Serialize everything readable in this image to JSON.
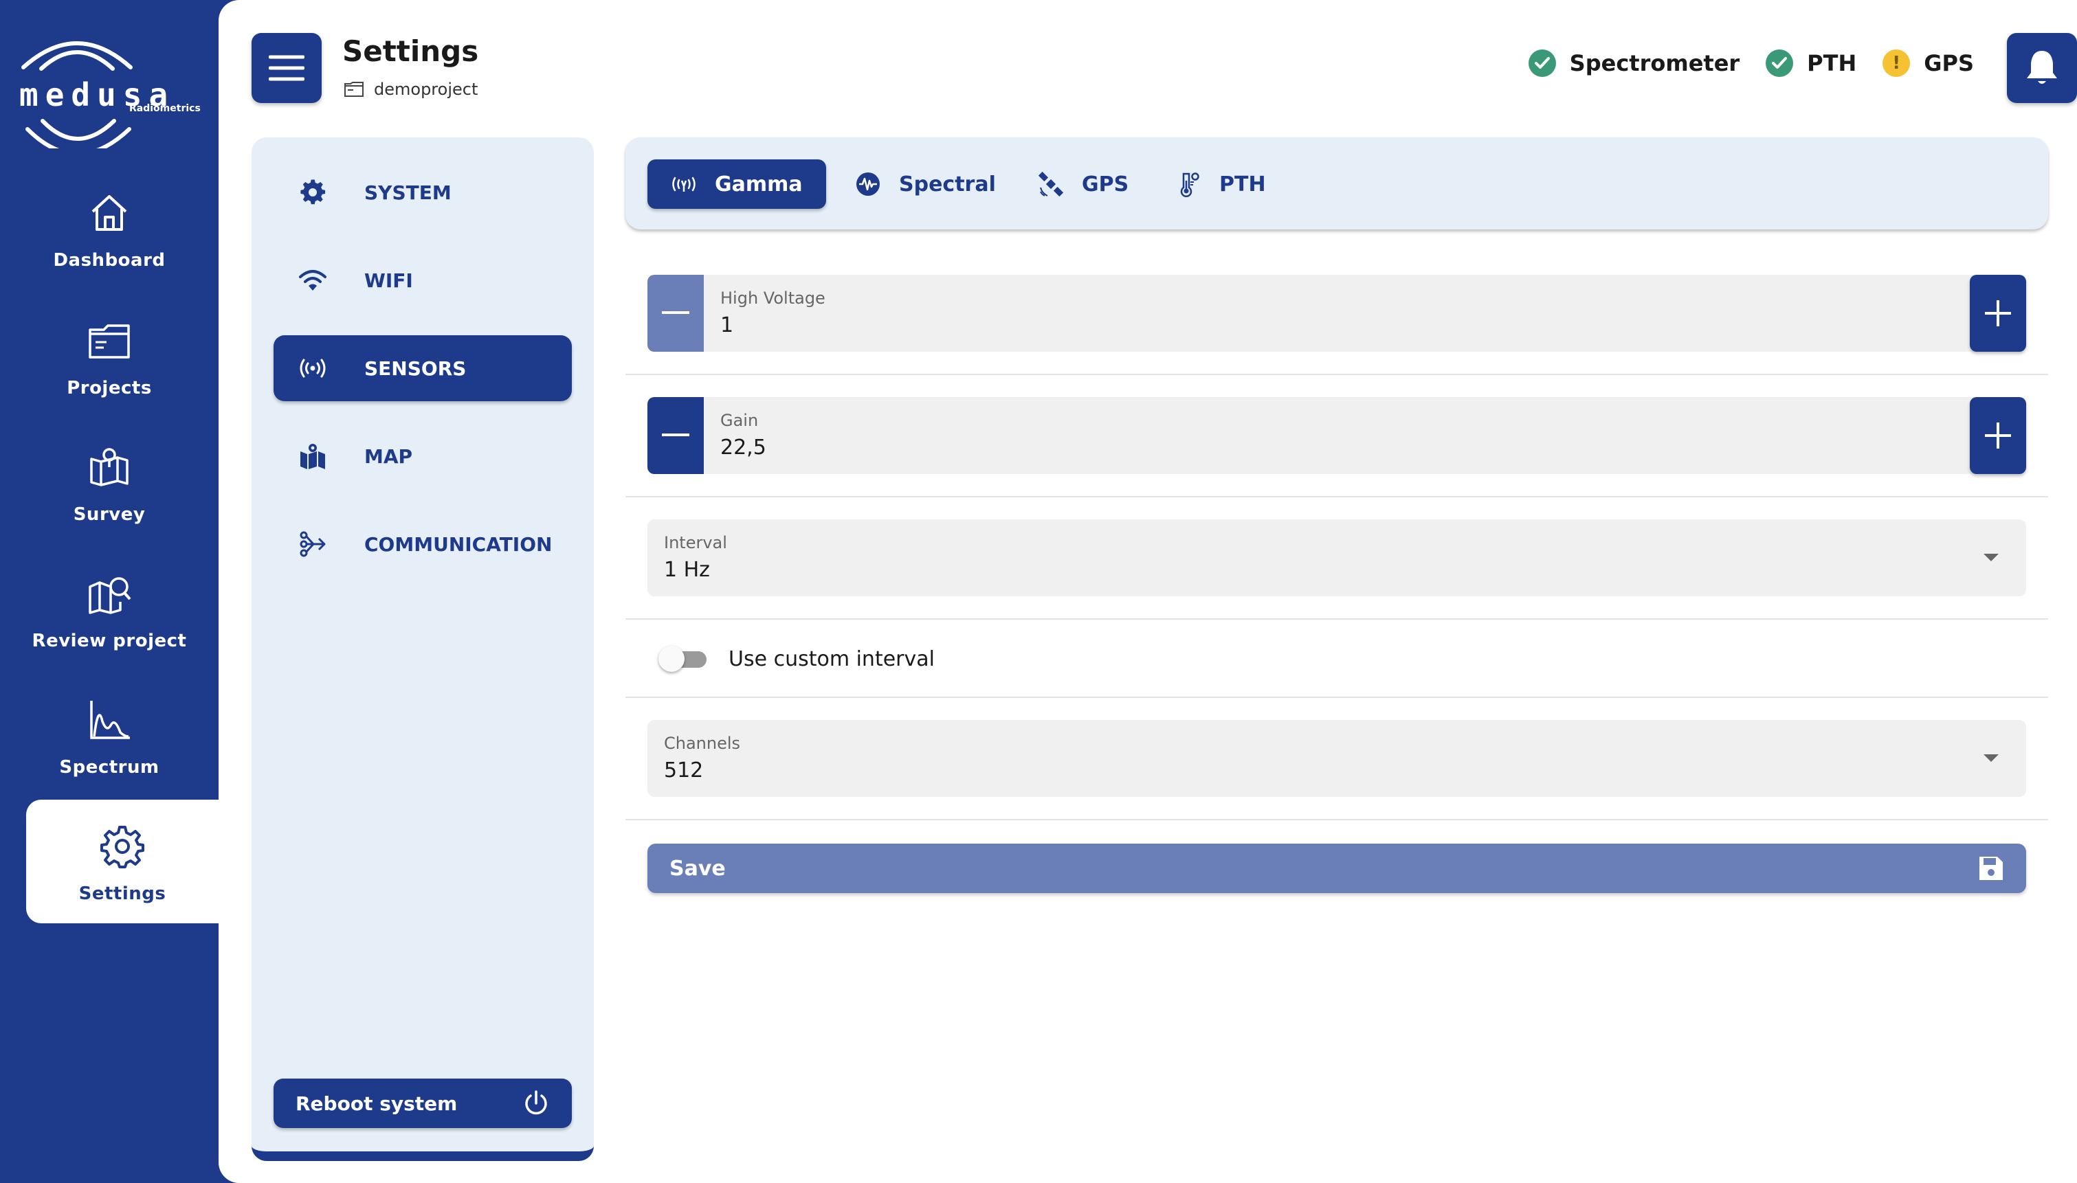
{
  "brand": {
    "name": "medusa",
    "tagline": "Radiometrics"
  },
  "sidebar": {
    "items": [
      {
        "label": "Dashboard",
        "icon": "home-icon"
      },
      {
        "label": "Projects",
        "icon": "folder-icon"
      },
      {
        "label": "Survey",
        "icon": "map-pin-icon"
      },
      {
        "label": "Review project",
        "icon": "map-search-icon"
      },
      {
        "label": "Spectrum",
        "icon": "spectrum-chart-icon"
      },
      {
        "label": "Settings",
        "icon": "gear-icon",
        "active": true
      }
    ]
  },
  "header": {
    "title": "Settings",
    "project": "demoproject",
    "statuses": [
      {
        "label": "Spectrometer",
        "state": "ok"
      },
      {
        "label": "PTH",
        "state": "ok"
      },
      {
        "label": "GPS",
        "state": "warning",
        "glyph": "!"
      }
    ]
  },
  "settings_menu": {
    "items": [
      {
        "label": "SYSTEM",
        "icon": "cog-icon"
      },
      {
        "label": "WIFI",
        "icon": "wifi-icon"
      },
      {
        "label": "SENSORS",
        "icon": "sensor-icon",
        "active": true
      },
      {
        "label": "MAP",
        "icon": "map-icon"
      },
      {
        "label": "COMMUNICATION",
        "icon": "share-icon"
      }
    ],
    "reboot_label": "Reboot system"
  },
  "tabs": [
    {
      "label": "Gamma",
      "icon": "gamma-icon",
      "active": true
    },
    {
      "label": "Spectral",
      "icon": "waveform-icon"
    },
    {
      "label": "GPS",
      "icon": "satellite-icon"
    },
    {
      "label": "PTH",
      "icon": "thermometer-icon"
    }
  ],
  "form": {
    "high_voltage": {
      "label": "High Voltage",
      "value": "1",
      "decrement_enabled": false
    },
    "gain": {
      "label": "Gain",
      "value": "22,5",
      "decrement_enabled": true
    },
    "interval": {
      "label": "Interval",
      "value": "1 Hz"
    },
    "custom_interval": {
      "label": "Use custom interval",
      "checked": false
    },
    "channels": {
      "label": "Channels",
      "value": "512"
    },
    "save_label": "Save"
  },
  "colors": {
    "primary": "#1e3a8a",
    "panel": "#e6eff8",
    "ok": "#3a9a78",
    "warning": "#f4c233",
    "disabled": "#6a7fb8"
  }
}
